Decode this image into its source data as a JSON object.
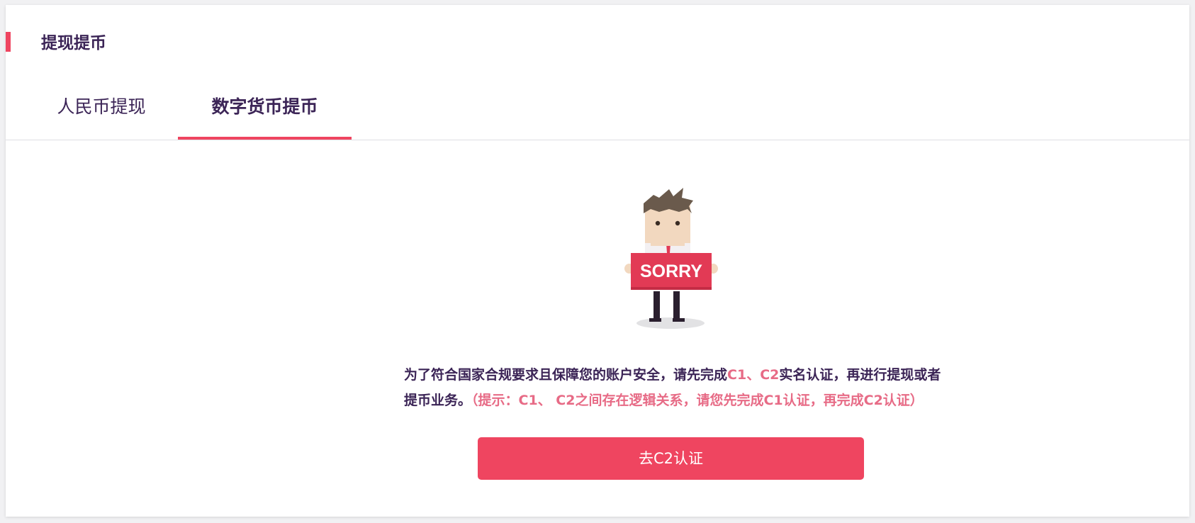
{
  "page": {
    "title": "提现提币"
  },
  "tabs": [
    {
      "label": "人民币提现",
      "active": false
    },
    {
      "label": "数字货币提币",
      "active": true
    }
  ],
  "illustration": {
    "icon": "sorry-man-icon",
    "sign_text": "SORRY"
  },
  "message": {
    "part1": "为了符合国家合规要求且保障您的账户安全，请先完成",
    "c1": "C1",
    "sep": "、",
    "c2": "C2",
    "part2": "实名认证，再进行提现或者提币业务。",
    "hint": "（提示：C1、 C2之间存在逻辑关系，请您先完成C1认证，再完成C2认证）"
  },
  "cta": {
    "label": "去C2认证"
  },
  "colors": {
    "accent": "#ef4560",
    "text": "#3b2456",
    "hint": "#e76b86"
  }
}
